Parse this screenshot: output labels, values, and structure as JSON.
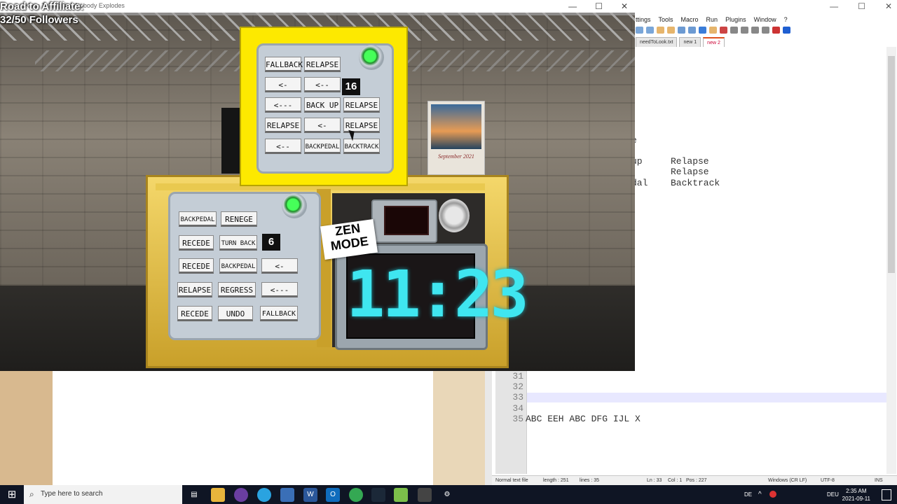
{
  "game_window": {
    "title": "Keep Talking and Nobody Explodes",
    "controls": {
      "minimize": "—",
      "maximize": "☐",
      "close": "✕"
    },
    "overlay": {
      "line1": "Road to Affiliate:",
      "line2": "32/50 Followers"
    }
  },
  "top_module": {
    "counter": "16",
    "buttons": [
      [
        "FALLBACK",
        "RELAPSE"
      ],
      [
        "<-",
        "<--"
      ],
      [
        "<---",
        "BACK UP",
        "RELAPSE"
      ],
      [
        "RELAPSE",
        "<-",
        "RELAPSE"
      ],
      [
        "<--",
        "BACKPEDAL",
        "BACKTRACK"
      ]
    ]
  },
  "bottom_left_module": {
    "counter": "6",
    "buttons": [
      [
        "BACKPEDAL",
        "RENEGE"
      ],
      [
        "RECEDE",
        "TURN BACK"
      ],
      [
        "RECEDE",
        "BACKPEDAL",
        "<-"
      ],
      [
        "RELAPSE",
        "REGRESS",
        "<---"
      ],
      [
        "RECEDE",
        "UNDO",
        "FALLBACK"
      ]
    ]
  },
  "timer": {
    "mode_label_1": "ZEN",
    "mode_label_2": "MODE",
    "digits": "11:23"
  },
  "calendar": {
    "label": "September 2021"
  },
  "notepad": {
    "menu": [
      "ttings",
      "Tools",
      "Macro",
      "Run",
      "Plugins",
      "Window",
      "?"
    ],
    "tabs": [
      "needToLook.txt",
      "new 1",
      "new 2"
    ],
    "upper_lines": [
      {
        "left": "e",
        "right": ""
      },
      {
        "left": "up",
        "right": "Relapse"
      },
      {
        "left": "",
        "right": "Relapse"
      },
      {
        "left": "dal",
        "right": "Backtrack"
      }
    ],
    "line_numbers": [
      "31",
      "32",
      "33",
      "34",
      "35"
    ],
    "line35": "ABC EEH ABC DFG IJL X",
    "status": {
      "type": "Normal text file",
      "length": "length : 251",
      "lines": "lines : 35",
      "ln": "Ln : 33",
      "col": "Col : 1",
      "pos": "Pos : 227",
      "eol": "Windows (CR LF)",
      "enc": "UTF-8",
      "ins": "INS"
    },
    "controls": {
      "minimize": "—",
      "maximize": "☐",
      "close": "✕"
    }
  },
  "taskbar": {
    "search_placeholder": "Type here to search",
    "lang": "DEU",
    "time": "2:35 AM",
    "date": "2021-09-11",
    "de": "DE"
  },
  "colors": {
    "timer_digit": "#3fe6f0",
    "led": "#46ff59",
    "case_top": "#fde900"
  }
}
